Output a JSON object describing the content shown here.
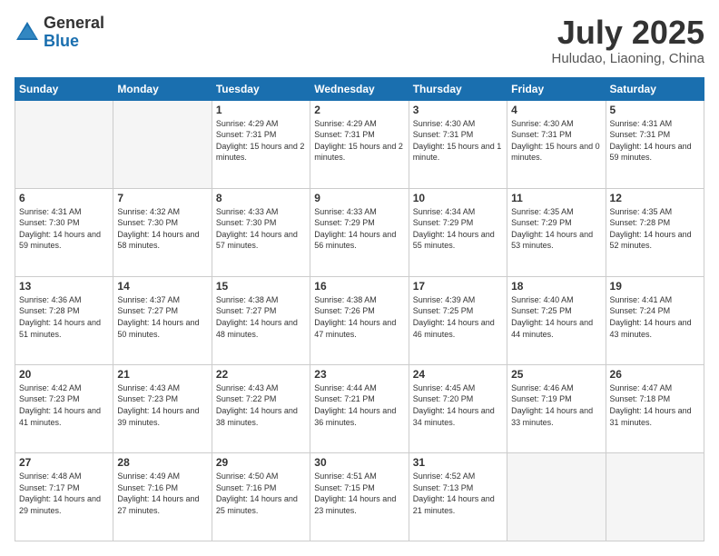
{
  "logo": {
    "general": "General",
    "blue": "Blue"
  },
  "header": {
    "month": "July 2025",
    "location": "Huludao, Liaoning, China"
  },
  "weekdays": [
    "Sunday",
    "Monday",
    "Tuesday",
    "Wednesday",
    "Thursday",
    "Friday",
    "Saturday"
  ],
  "weeks": [
    [
      {
        "day": "",
        "empty": true
      },
      {
        "day": "",
        "empty": true
      },
      {
        "day": "1",
        "sunrise": "Sunrise: 4:29 AM",
        "sunset": "Sunset: 7:31 PM",
        "daylight": "Daylight: 15 hours and 2 minutes."
      },
      {
        "day": "2",
        "sunrise": "Sunrise: 4:29 AM",
        "sunset": "Sunset: 7:31 PM",
        "daylight": "Daylight: 15 hours and 2 minutes."
      },
      {
        "day": "3",
        "sunrise": "Sunrise: 4:30 AM",
        "sunset": "Sunset: 7:31 PM",
        "daylight": "Daylight: 15 hours and 1 minute."
      },
      {
        "day": "4",
        "sunrise": "Sunrise: 4:30 AM",
        "sunset": "Sunset: 7:31 PM",
        "daylight": "Daylight: 15 hours and 0 minutes."
      },
      {
        "day": "5",
        "sunrise": "Sunrise: 4:31 AM",
        "sunset": "Sunset: 7:31 PM",
        "daylight": "Daylight: 14 hours and 59 minutes."
      }
    ],
    [
      {
        "day": "6",
        "sunrise": "Sunrise: 4:31 AM",
        "sunset": "Sunset: 7:30 PM",
        "daylight": "Daylight: 14 hours and 59 minutes."
      },
      {
        "day": "7",
        "sunrise": "Sunrise: 4:32 AM",
        "sunset": "Sunset: 7:30 PM",
        "daylight": "Daylight: 14 hours and 58 minutes."
      },
      {
        "day": "8",
        "sunrise": "Sunrise: 4:33 AM",
        "sunset": "Sunset: 7:30 PM",
        "daylight": "Daylight: 14 hours and 57 minutes."
      },
      {
        "day": "9",
        "sunrise": "Sunrise: 4:33 AM",
        "sunset": "Sunset: 7:29 PM",
        "daylight": "Daylight: 14 hours and 56 minutes."
      },
      {
        "day": "10",
        "sunrise": "Sunrise: 4:34 AM",
        "sunset": "Sunset: 7:29 PM",
        "daylight": "Daylight: 14 hours and 55 minutes."
      },
      {
        "day": "11",
        "sunrise": "Sunrise: 4:35 AM",
        "sunset": "Sunset: 7:29 PM",
        "daylight": "Daylight: 14 hours and 53 minutes."
      },
      {
        "day": "12",
        "sunrise": "Sunrise: 4:35 AM",
        "sunset": "Sunset: 7:28 PM",
        "daylight": "Daylight: 14 hours and 52 minutes."
      }
    ],
    [
      {
        "day": "13",
        "sunrise": "Sunrise: 4:36 AM",
        "sunset": "Sunset: 7:28 PM",
        "daylight": "Daylight: 14 hours and 51 minutes."
      },
      {
        "day": "14",
        "sunrise": "Sunrise: 4:37 AM",
        "sunset": "Sunset: 7:27 PM",
        "daylight": "Daylight: 14 hours and 50 minutes."
      },
      {
        "day": "15",
        "sunrise": "Sunrise: 4:38 AM",
        "sunset": "Sunset: 7:27 PM",
        "daylight": "Daylight: 14 hours and 48 minutes."
      },
      {
        "day": "16",
        "sunrise": "Sunrise: 4:38 AM",
        "sunset": "Sunset: 7:26 PM",
        "daylight": "Daylight: 14 hours and 47 minutes."
      },
      {
        "day": "17",
        "sunrise": "Sunrise: 4:39 AM",
        "sunset": "Sunset: 7:25 PM",
        "daylight": "Daylight: 14 hours and 46 minutes."
      },
      {
        "day": "18",
        "sunrise": "Sunrise: 4:40 AM",
        "sunset": "Sunset: 7:25 PM",
        "daylight": "Daylight: 14 hours and 44 minutes."
      },
      {
        "day": "19",
        "sunrise": "Sunrise: 4:41 AM",
        "sunset": "Sunset: 7:24 PM",
        "daylight": "Daylight: 14 hours and 43 minutes."
      }
    ],
    [
      {
        "day": "20",
        "sunrise": "Sunrise: 4:42 AM",
        "sunset": "Sunset: 7:23 PM",
        "daylight": "Daylight: 14 hours and 41 minutes."
      },
      {
        "day": "21",
        "sunrise": "Sunrise: 4:43 AM",
        "sunset": "Sunset: 7:23 PM",
        "daylight": "Daylight: 14 hours and 39 minutes."
      },
      {
        "day": "22",
        "sunrise": "Sunrise: 4:43 AM",
        "sunset": "Sunset: 7:22 PM",
        "daylight": "Daylight: 14 hours and 38 minutes."
      },
      {
        "day": "23",
        "sunrise": "Sunrise: 4:44 AM",
        "sunset": "Sunset: 7:21 PM",
        "daylight": "Daylight: 14 hours and 36 minutes."
      },
      {
        "day": "24",
        "sunrise": "Sunrise: 4:45 AM",
        "sunset": "Sunset: 7:20 PM",
        "daylight": "Daylight: 14 hours and 34 minutes."
      },
      {
        "day": "25",
        "sunrise": "Sunrise: 4:46 AM",
        "sunset": "Sunset: 7:19 PM",
        "daylight": "Daylight: 14 hours and 33 minutes."
      },
      {
        "day": "26",
        "sunrise": "Sunrise: 4:47 AM",
        "sunset": "Sunset: 7:18 PM",
        "daylight": "Daylight: 14 hours and 31 minutes."
      }
    ],
    [
      {
        "day": "27",
        "sunrise": "Sunrise: 4:48 AM",
        "sunset": "Sunset: 7:17 PM",
        "daylight": "Daylight: 14 hours and 29 minutes."
      },
      {
        "day": "28",
        "sunrise": "Sunrise: 4:49 AM",
        "sunset": "Sunset: 7:16 PM",
        "daylight": "Daylight: 14 hours and 27 minutes."
      },
      {
        "day": "29",
        "sunrise": "Sunrise: 4:50 AM",
        "sunset": "Sunset: 7:16 PM",
        "daylight": "Daylight: 14 hours and 25 minutes."
      },
      {
        "day": "30",
        "sunrise": "Sunrise: 4:51 AM",
        "sunset": "Sunset: 7:15 PM",
        "daylight": "Daylight: 14 hours and 23 minutes."
      },
      {
        "day": "31",
        "sunrise": "Sunrise: 4:52 AM",
        "sunset": "Sunset: 7:13 PM",
        "daylight": "Daylight: 14 hours and 21 minutes."
      },
      {
        "day": "",
        "empty": true
      },
      {
        "day": "",
        "empty": true
      }
    ]
  ]
}
